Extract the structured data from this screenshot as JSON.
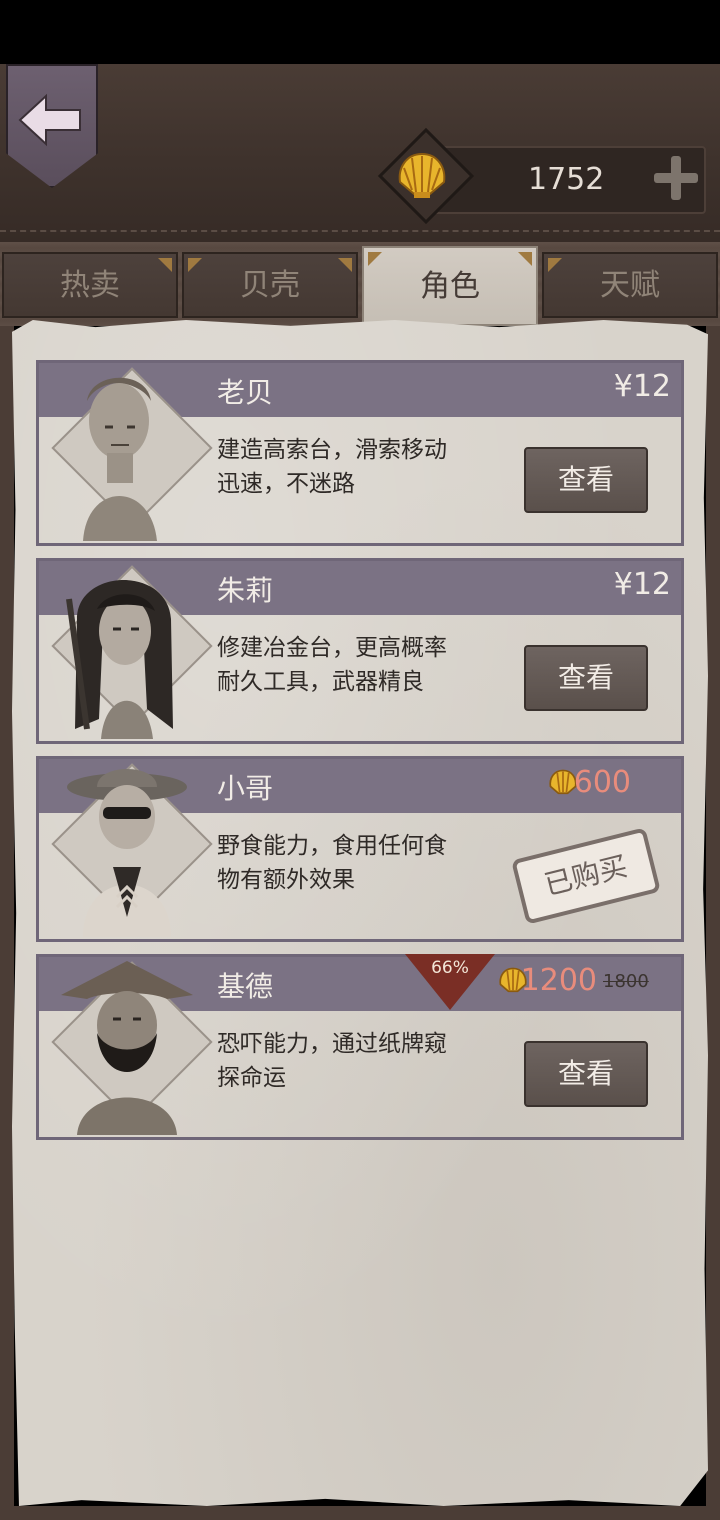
{
  "currency": {
    "amount": "1752"
  },
  "tabs": [
    {
      "label": "热卖"
    },
    {
      "label": "贝壳"
    },
    {
      "label": "角色"
    },
    {
      "label": "天赋"
    }
  ],
  "active_tab": "角色",
  "characters": [
    {
      "name": "老贝",
      "price": "¥12",
      "desc": "建造高索台，滑索移动迅速，不迷路",
      "action": "查看"
    },
    {
      "name": "朱莉",
      "price": "¥12",
      "desc": "修建冶金台，更高概率耐久工具，武器精良",
      "action": "查看"
    },
    {
      "name": "小哥",
      "price": "600",
      "desc": "野食能力，食用任何食物有额外效果",
      "status": "已购买"
    },
    {
      "name": "基德",
      "price": "1200",
      "original_price": "1800",
      "discount": "66%",
      "desc": "恐吓能力，通过纸牌窥探命运",
      "action": "查看"
    }
  ],
  "colors": {
    "header_leather": "#3e322c",
    "card_header": "#7b7284",
    "parchment": "#d8d3cb",
    "shell_price": "#e88c7c",
    "discount": "#7a2e25"
  }
}
